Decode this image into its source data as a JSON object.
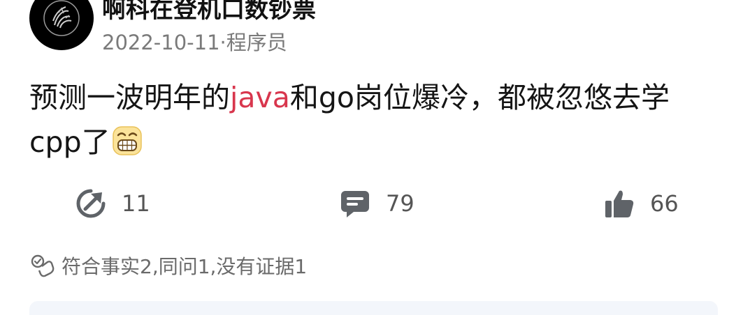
{
  "user": {
    "name": "啊科在登机口数钞票",
    "date": "2022-10-11",
    "separator": "·",
    "role": "程序员"
  },
  "post": {
    "line1_before": "预测一波明年的",
    "keyword": "java",
    "line1_after": "和go岗位爆冷，都被忽悠去学",
    "line2": "cpp了",
    "emoji_icon": "grinning-emoji-icon",
    "keyword_color": "#d8364d"
  },
  "actions": {
    "share_count": "11",
    "comment_count": "79",
    "like_count": "66",
    "share_icon": "share-icon",
    "comment_icon": "comment-icon",
    "like_icon": "thumbs-up-icon"
  },
  "evaluation": {
    "text": "符合事实2,同问1,没有证据1",
    "icon": "evaluation-icon"
  }
}
